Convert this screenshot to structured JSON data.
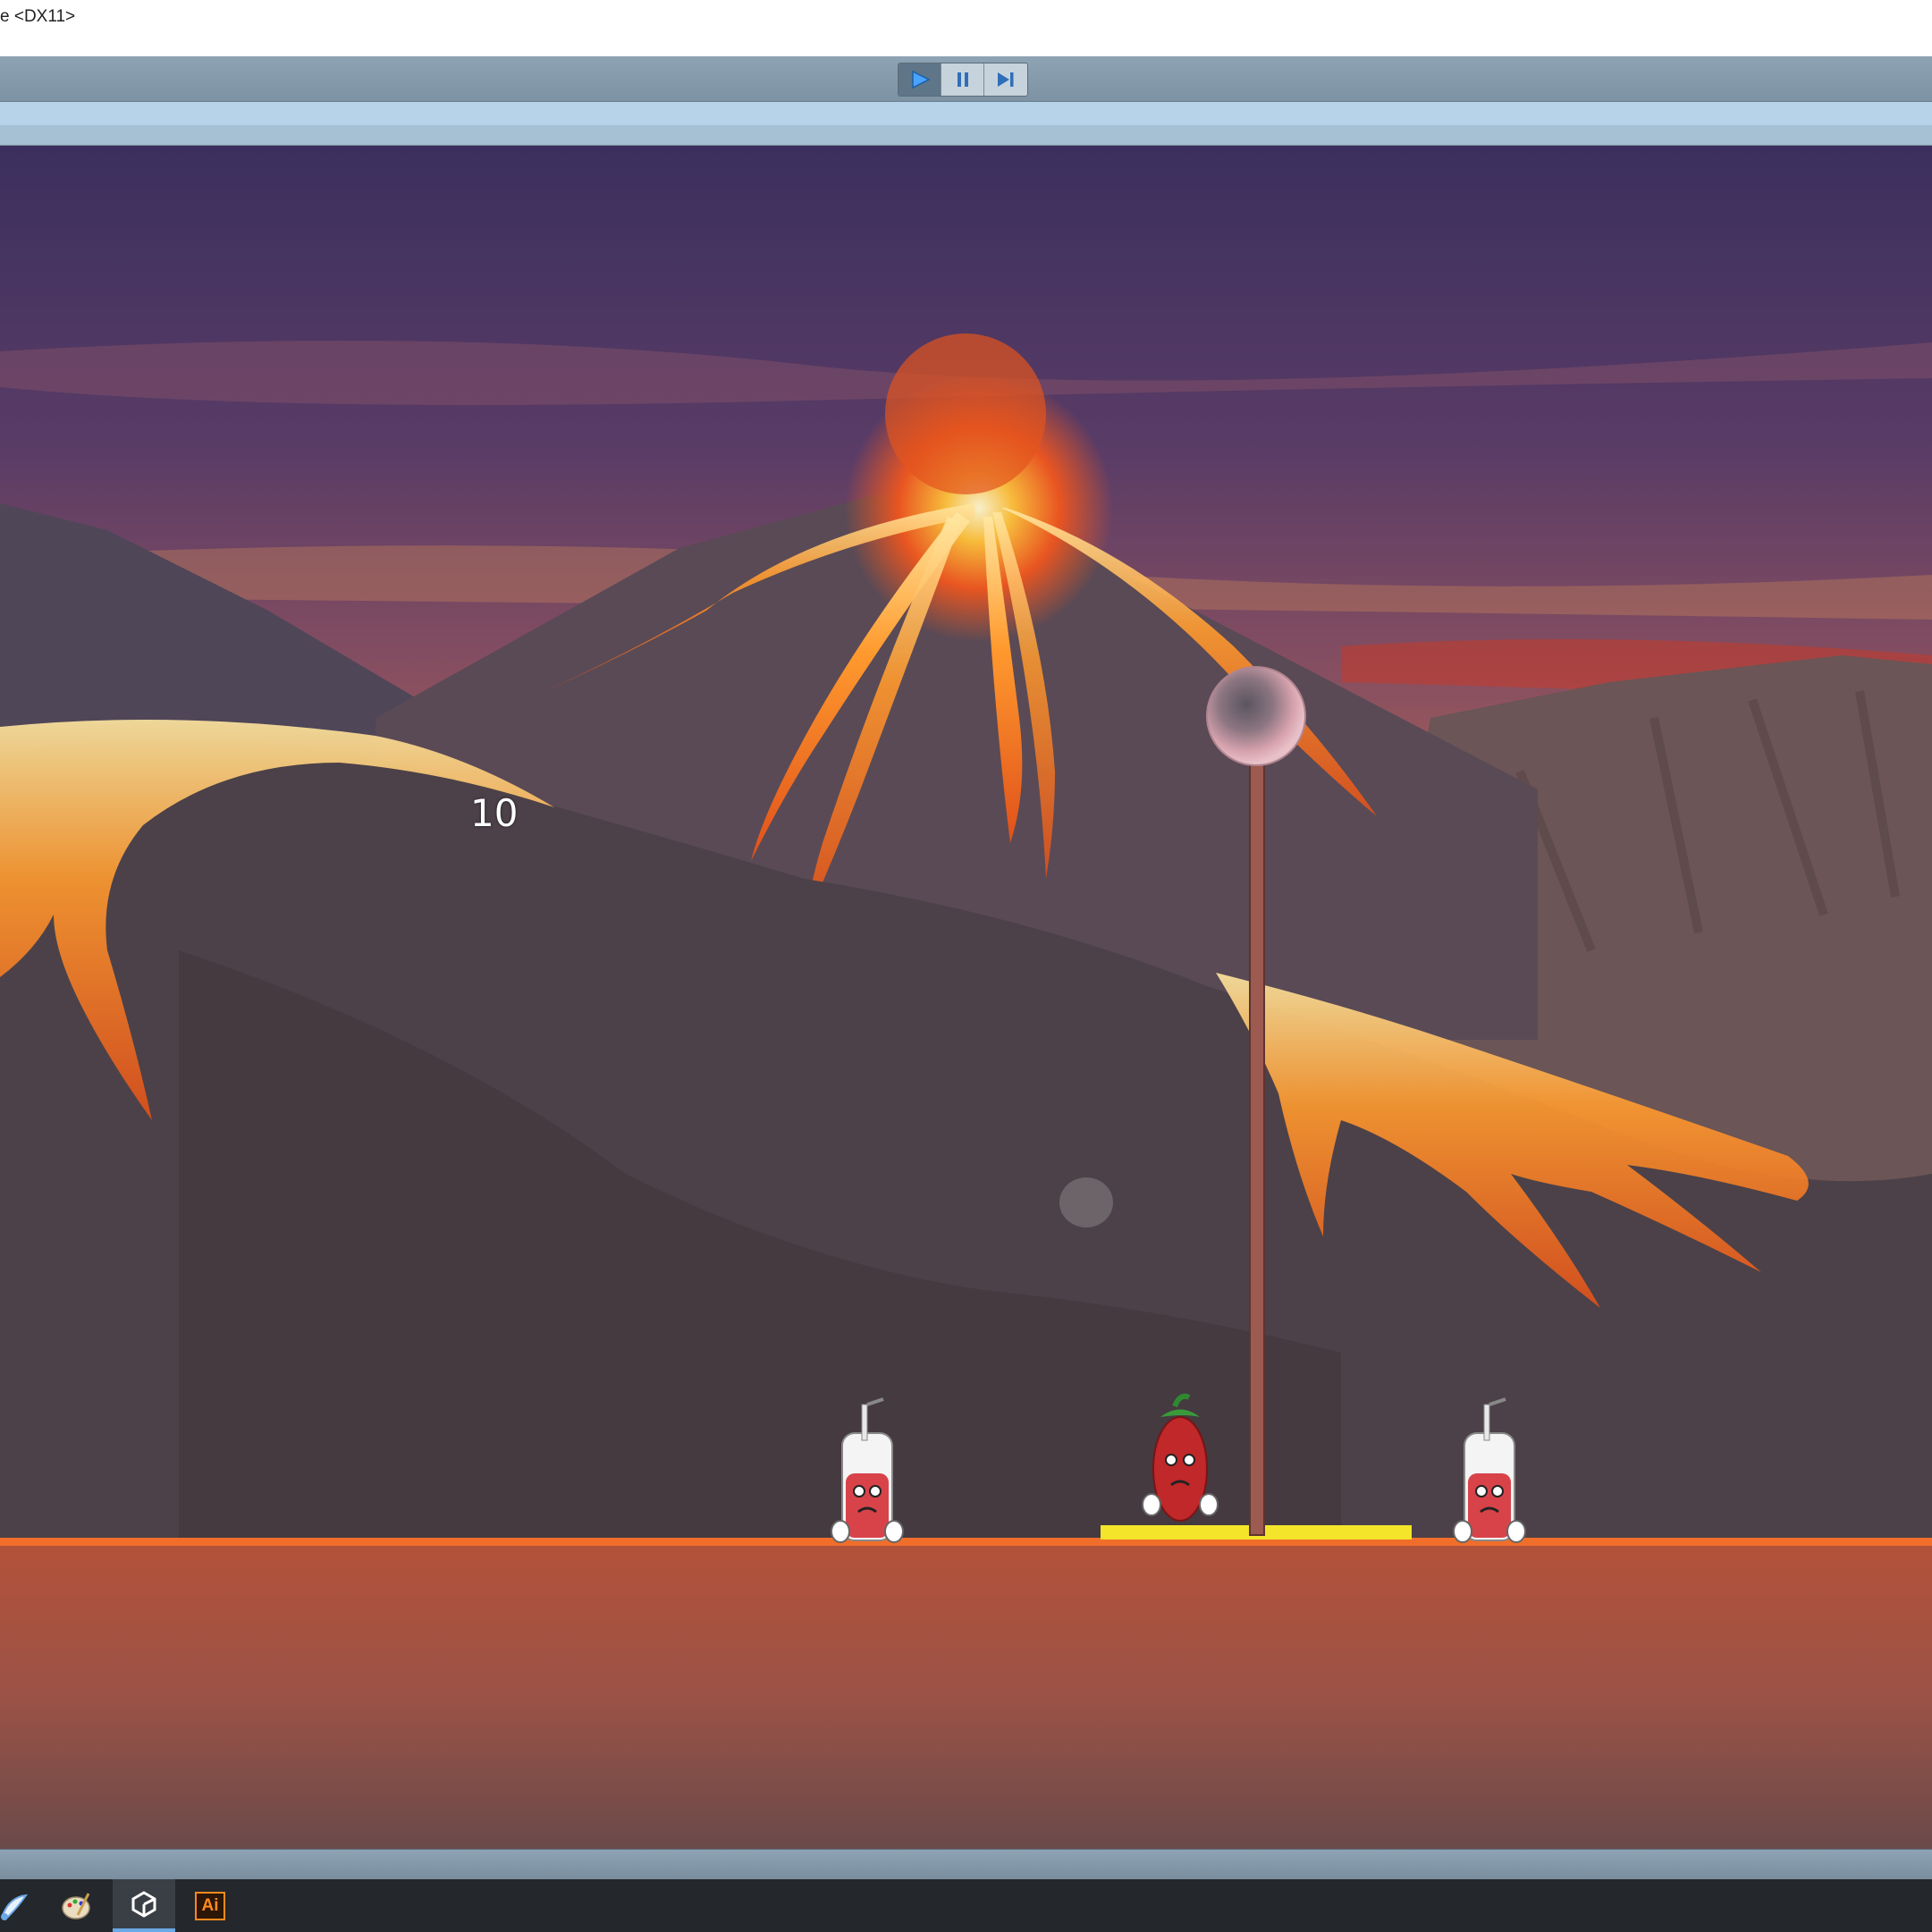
{
  "window": {
    "title": "e <DX11>"
  },
  "toolbar": {
    "play_icon": "play-icon",
    "pause_icon": "pause-icon",
    "step_icon": "step-icon"
  },
  "game": {
    "score": "10",
    "characters": [
      "milk-bottle-character",
      "chili-pepper-character",
      "milk-bottle-character"
    ],
    "colors": {
      "sky_top": "#3d2e5c",
      "lava": "#f07a2a",
      "ground": "#b5573c",
      "pad": "#f4e52a",
      "ball": "#d49aa6"
    }
  },
  "taskbar": {
    "items": [
      "paint-app-icon",
      "palette-app-icon",
      "unity-icon",
      "illustrator-icon"
    ],
    "illustrator_label": "Ai"
  }
}
